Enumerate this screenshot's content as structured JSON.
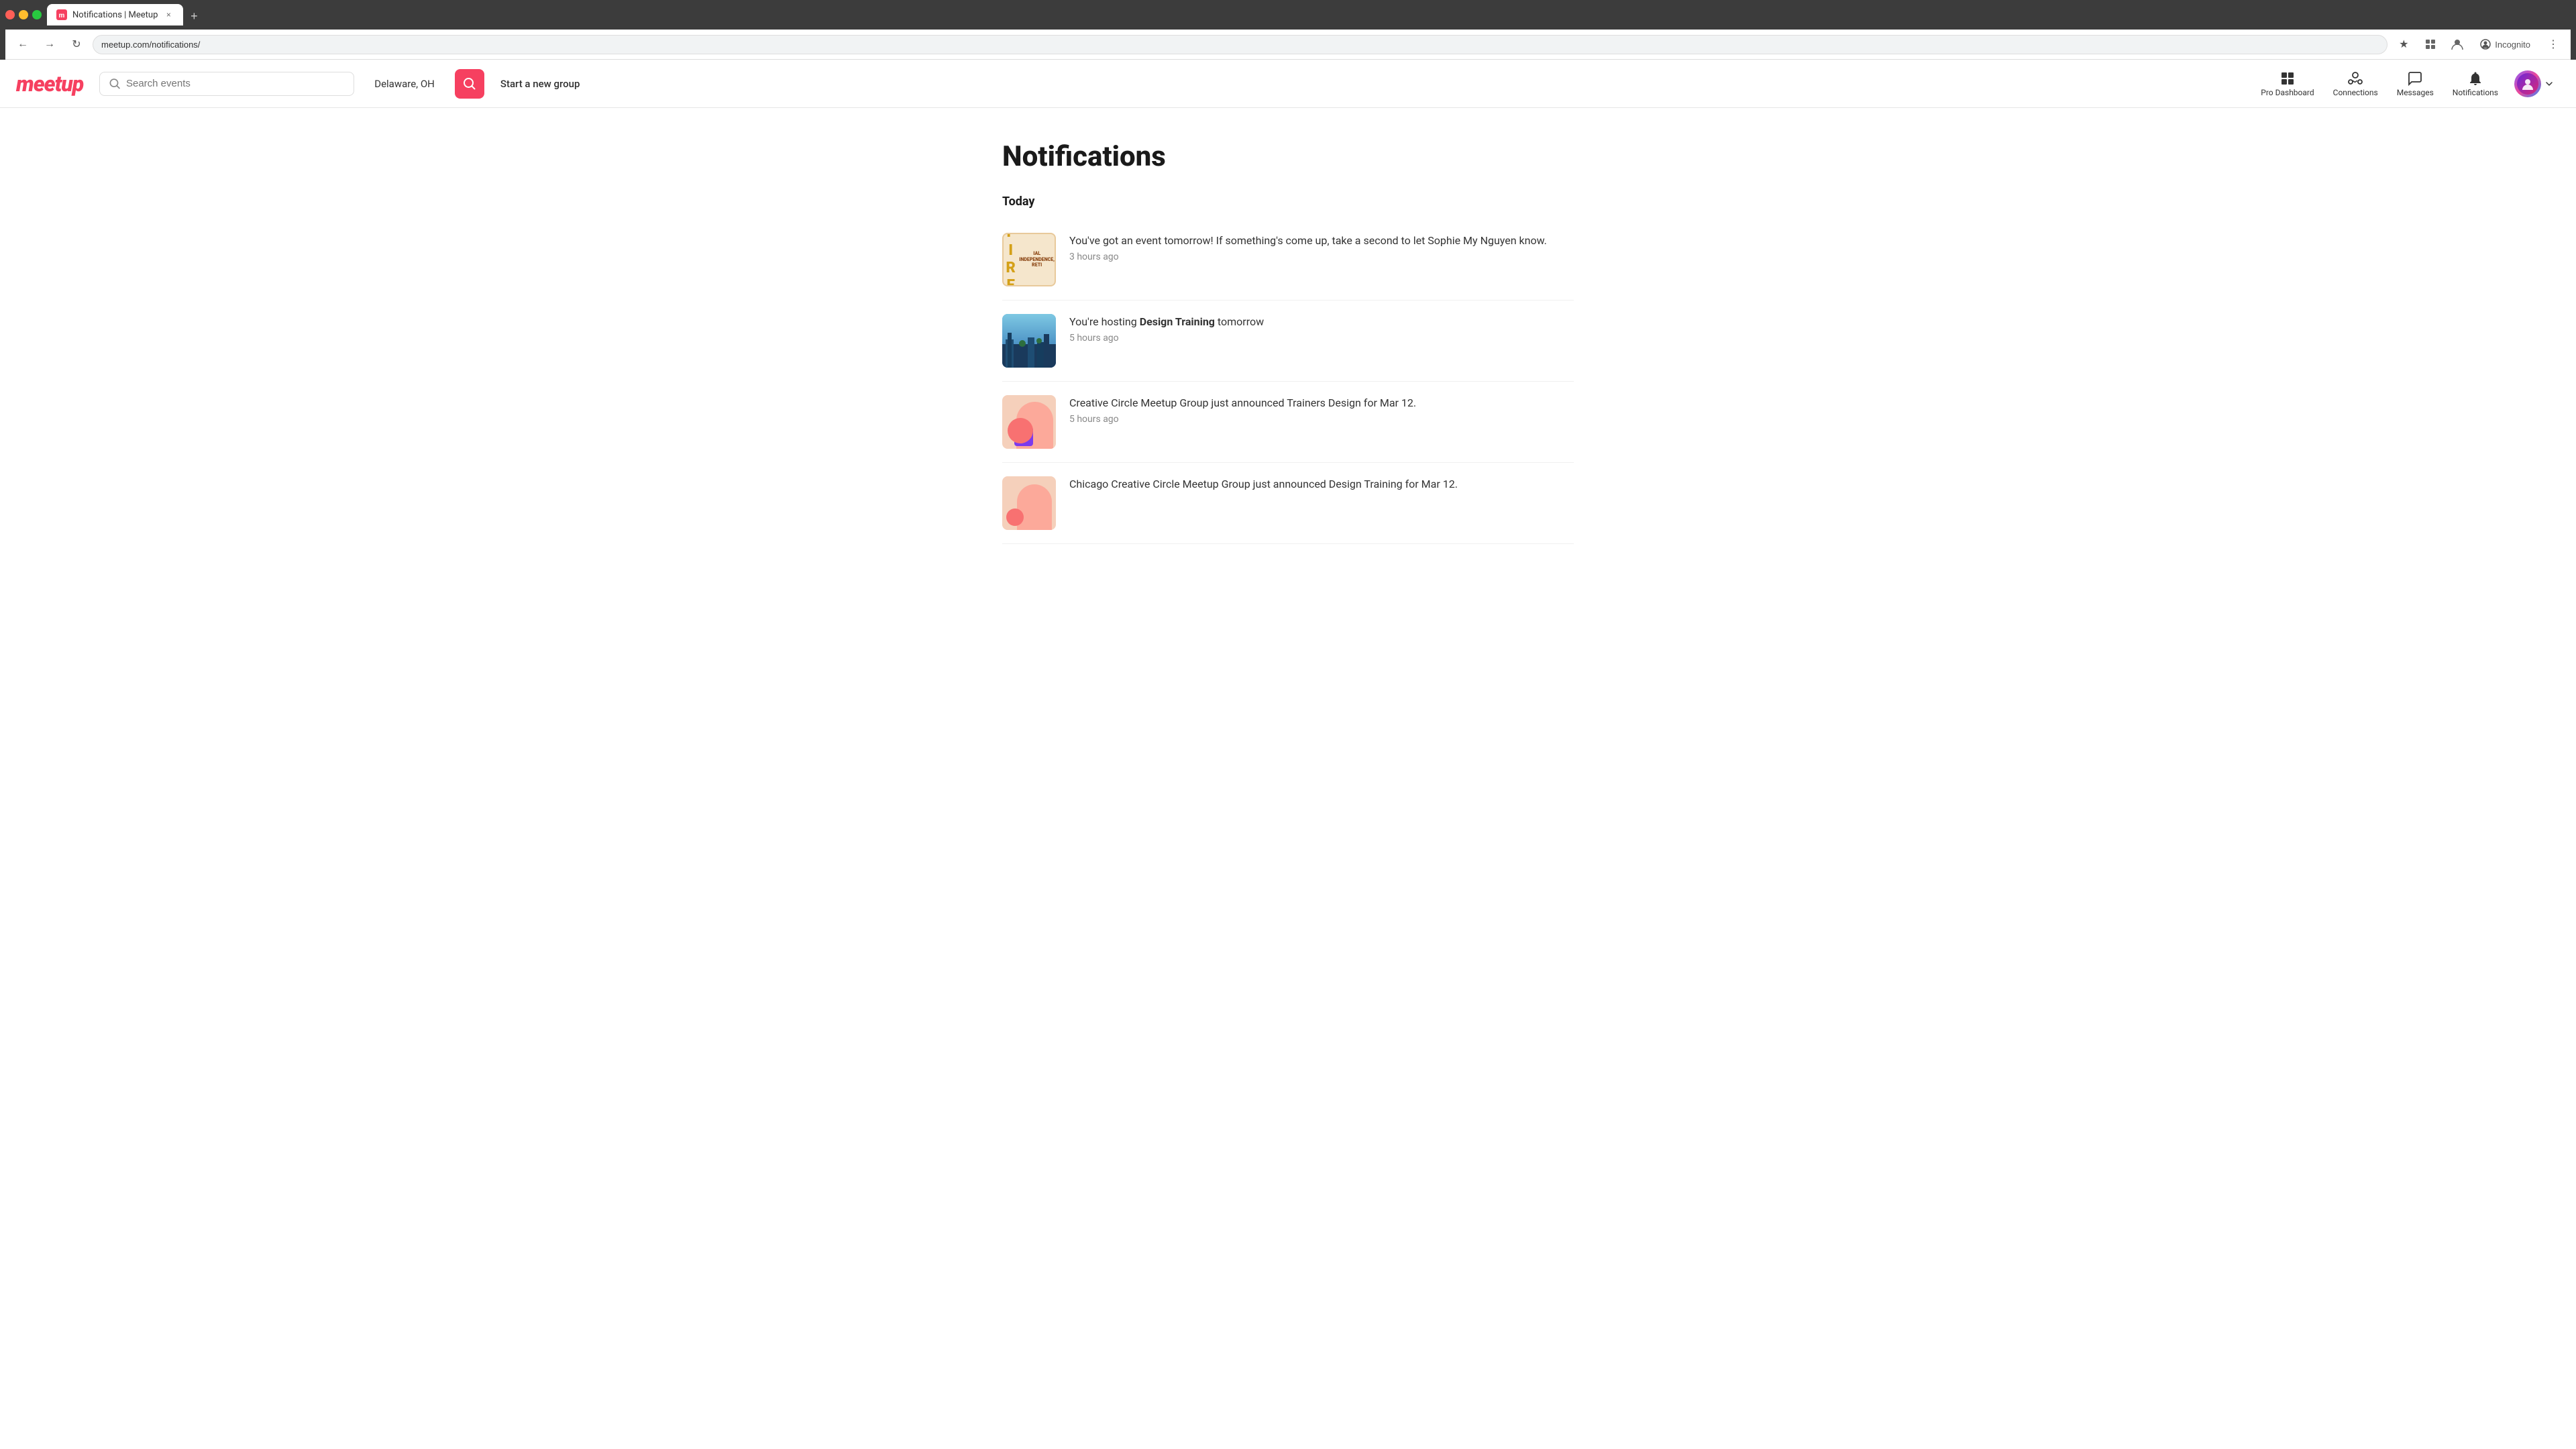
{
  "browser": {
    "tab_title": "Notifications | Meetup",
    "url": "meetup.com/notifications/",
    "new_tab_label": "+",
    "close_label": "×",
    "back_disabled": false,
    "forward_disabled": true,
    "incognito_label": "Incognito"
  },
  "header": {
    "logo": "meetup",
    "search_placeholder": "Search events",
    "location": "Delaware, OH",
    "search_btn_label": "🔍",
    "start_group_label": "Start a new group",
    "nav": {
      "pro_dashboard_label": "Pro Dashboard",
      "connections_label": "Connections",
      "messages_label": "Messages",
      "notifications_label": "Notifications"
    }
  },
  "page": {
    "title": "Notifications",
    "section_today": "Today",
    "notifications": [
      {
        "id": 1,
        "thumb_type": "fire",
        "fire_letters": "F I R E",
        "fire_sub": "IAL INDEPENDENCE, RETI",
        "message": "You've got an event tomorrow! If something's come up, take a second to let Sophie My Nguyen know.",
        "time": "3 hours ago"
      },
      {
        "id": 2,
        "thumb_type": "city",
        "message_prefix": "You're hosting ",
        "message_bold": "Design Training",
        "message_suffix": " tomorrow",
        "time": "5 hours ago"
      },
      {
        "id": 3,
        "thumb_type": "creative",
        "message": "Creative Circle Meetup Group just announced Trainers Design for Mar 12.",
        "time": "5 hours ago"
      },
      {
        "id": 4,
        "thumb_type": "chicago",
        "message": "Chicago Creative Circle Meetup Group just announced Design Training for Mar 12.",
        "time": ""
      }
    ]
  }
}
